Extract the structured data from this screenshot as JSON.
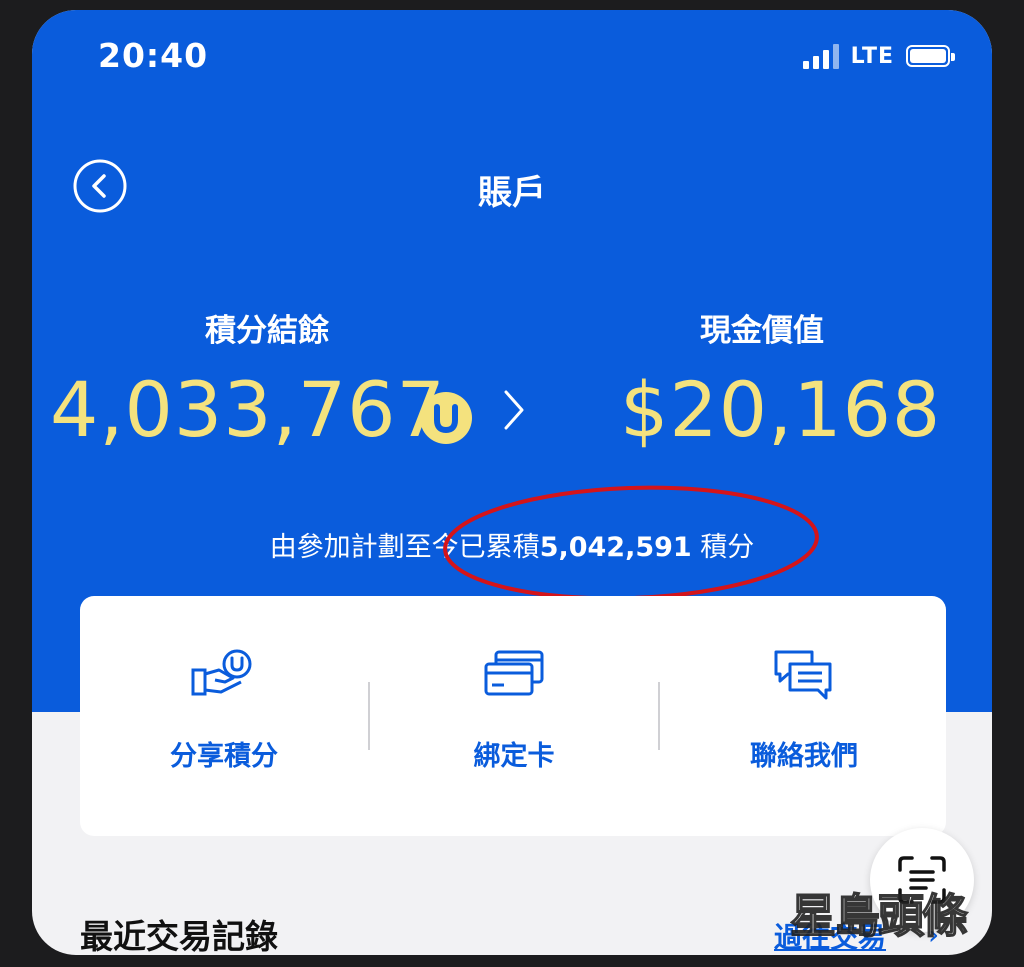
{
  "status_bar": {
    "time": "20:40",
    "network": "LTE"
  },
  "header": {
    "title": "賬戶"
  },
  "balance": {
    "points_label": "積分結餘",
    "points_value": "4,033,767",
    "cash_label": "現金價值",
    "cash_value": "$20,168"
  },
  "accumulated": {
    "prefix": "由參加計劃至今已累積",
    "amount": "5,042,591",
    "suffix": " 積分"
  },
  "actions": [
    {
      "label": "分享積分",
      "icon": "share-points-icon"
    },
    {
      "label": "綁定卡",
      "icon": "bind-card-icon"
    },
    {
      "label": "聯絡我們",
      "icon": "chat-icon"
    }
  ],
  "recent": {
    "title": "最近交易記錄",
    "link_label": "過往交易"
  },
  "watermark": {
    "text": "星島頭條"
  },
  "colors": {
    "brand_blue": "#0a5cdc",
    "points_yellow": "#f4e27e",
    "highlight_red": "#d4141a"
  }
}
